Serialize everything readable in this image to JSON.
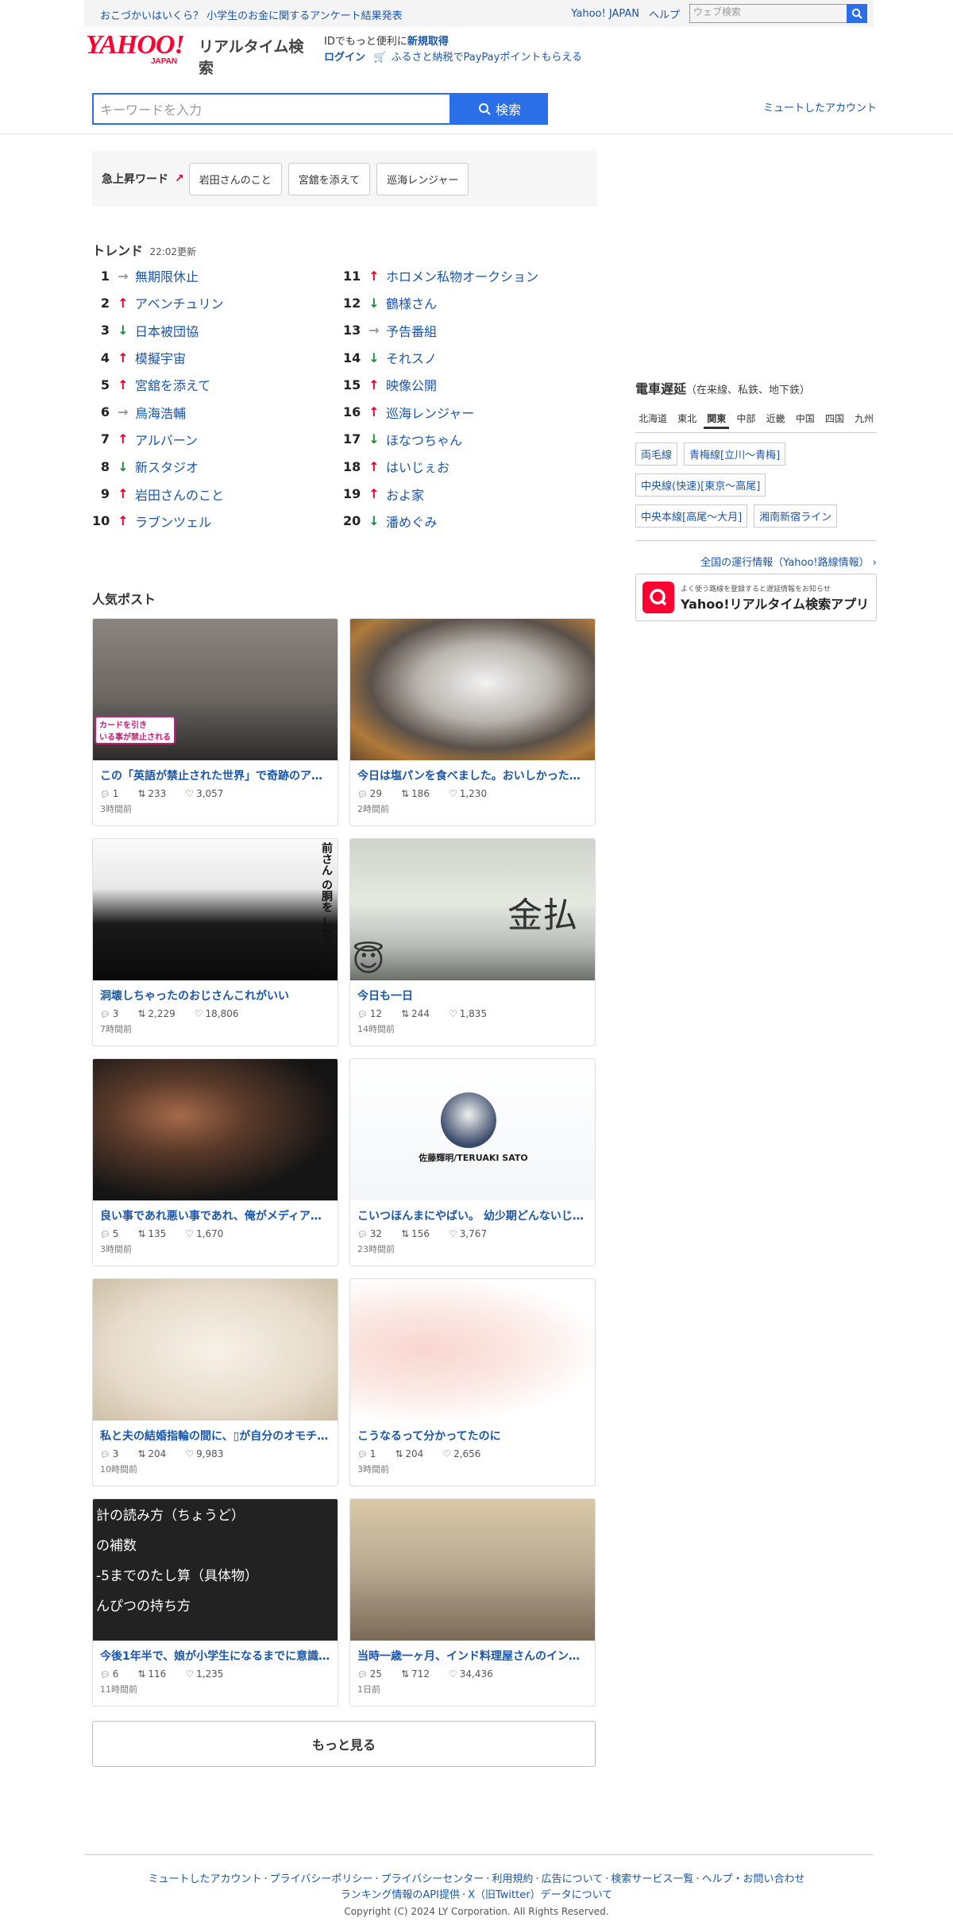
{
  "topbar": {
    "links": [
      "おこづかいはいくら？ 小学生のお金に関するアンケート結果発表"
    ],
    "yahoo_japan": "Yahoo! JAPAN",
    "help": "ヘルプ",
    "search_placeholder": "ウェブ検索"
  },
  "header": {
    "logo_text": "YAHOO!",
    "logo_sub": "JAPAN",
    "service_name": "リアルタイム検索",
    "info_prefix": "IDでもっと便利に",
    "info_register": "新規取得",
    "login": "ログイン",
    "furusato": "ふるさと納税でPayPayポイントもらえる",
    "search_placeholder": "キーワードを入力",
    "search_button": "検索",
    "muted_accounts": "ミュートしたアカウント"
  },
  "rising": {
    "label": "急上昇ワード",
    "words": [
      "岩田さんのこと",
      "宮舘を添えて",
      "巡海レンジャー"
    ]
  },
  "trends": {
    "title": "トレンド",
    "updated": "22:02更新",
    "items": [
      {
        "rank": "1",
        "dir": "same",
        "word": "無期限休止"
      },
      {
        "rank": "2",
        "dir": "up",
        "word": "アベンチュリン"
      },
      {
        "rank": "3",
        "dir": "down",
        "word": "日本被団協"
      },
      {
        "rank": "4",
        "dir": "up",
        "word": "模擬宇宙"
      },
      {
        "rank": "5",
        "dir": "up",
        "word": "宮舘を添えて"
      },
      {
        "rank": "6",
        "dir": "same",
        "word": "鳥海浩輔"
      },
      {
        "rank": "7",
        "dir": "up",
        "word": "アルバーン"
      },
      {
        "rank": "8",
        "dir": "down",
        "word": "新スタジオ"
      },
      {
        "rank": "9",
        "dir": "up",
        "word": "岩田さんのこと"
      },
      {
        "rank": "10",
        "dir": "up",
        "word": "ラブンツェル"
      },
      {
        "rank": "11",
        "dir": "up",
        "word": "ホロメン私物オークション"
      },
      {
        "rank": "12",
        "dir": "down",
        "word": "鶴様さん"
      },
      {
        "rank": "13",
        "dir": "same",
        "word": "予告番組"
      },
      {
        "rank": "14",
        "dir": "down",
        "word": "それスノ"
      },
      {
        "rank": "15",
        "dir": "up",
        "word": "映像公開"
      },
      {
        "rank": "16",
        "dir": "up",
        "word": "巡海レンジャー"
      },
      {
        "rank": "17",
        "dir": "down",
        "word": "ほなつちゃん"
      },
      {
        "rank": "18",
        "dir": "up",
        "word": "はいじぇお"
      },
      {
        "rank": "19",
        "dir": "up",
        "word": "およ家"
      },
      {
        "rank": "20",
        "dir": "down",
        "word": "潘めぐみ"
      }
    ]
  },
  "posts": {
    "title": "人気ポスト",
    "items": [
      {
        "title": "この「英語が禁止された世界」で奇跡のア…",
        "replies": "1",
        "reposts": "233",
        "likes": "3,057",
        "time": "3時間前",
        "img_caption": "カードを引き\nいる事が禁止される"
      },
      {
        "title": "今日は塩パンを食べました。おいしかった…",
        "replies": "29",
        "reposts": "186",
        "likes": "1,230",
        "time": "2時間前",
        "img_caption": ""
      },
      {
        "title": "洞壊しちゃったのおじさんこれがいい",
        "replies": "3",
        "reposts": "2,229",
        "likes": "18,806",
        "time": "7時間前",
        "img_caption": "前さん の胴を したのか⁉"
      },
      {
        "title": "今日も一日",
        "replies": "12",
        "reposts": "244",
        "likes": "1,835",
        "time": "14時間前",
        "img_caption": "金払"
      },
      {
        "title": "良い事であれ悪い事であれ、俺がメディア…",
        "replies": "5",
        "reposts": "135",
        "likes": "1,670",
        "time": "3時間前",
        "img_caption": ""
      },
      {
        "title": "こいつほんまにやばい。 幼少期どんないじ…",
        "replies": "32",
        "reposts": "156",
        "likes": "3,767",
        "time": "23時間前",
        "img_caption": "佐藤輝明/TERUAKI SATO"
      },
      {
        "title": "私と夫の結婚指輪の間に、▯が自分のオモチ…",
        "replies": "3",
        "reposts": "204",
        "likes": "9,983",
        "time": "10時間前",
        "img_caption": ""
      },
      {
        "title": "こうなるって分かってたのに",
        "replies": "1",
        "reposts": "204",
        "likes": "2,656",
        "time": "3時間前",
        "img_caption": ""
      },
      {
        "title": "今後1年半で、娘が小学生になるまでに意識…",
        "replies": "6",
        "reposts": "116",
        "likes": "1,235",
        "time": "11時間前",
        "img_caption": "計の読み方（ちょうど）\nの補数\n-5までのたし算（具体物）\nんぴつの持ち方"
      },
      {
        "title": "当時一歳一ヶ月、インド料理屋さんのイン…",
        "replies": "25",
        "reposts": "712",
        "likes": "34,436",
        "time": "1日前",
        "img_caption": ""
      }
    ],
    "more": "もっと見る"
  },
  "train": {
    "title": "電車遅延",
    "subtitle": "（在来線、私鉄、地下鉄）",
    "regions": [
      "北海道",
      "東北",
      "関東",
      "中部",
      "近畿",
      "中国",
      "四国",
      "九州"
    ],
    "active_region": "関東",
    "lines": [
      "両毛線",
      "青梅線[立川〜青梅]",
      "中央線(快速)[東京〜高尾]",
      "中央本線[高尾〜大月]",
      "湘南新宿ライン"
    ],
    "all_link": "全国の運行情報（Yahoo!路線情報）",
    "app_small": "よく使う路線を登録すると遅延情報をお知らせ",
    "app_name": "Yahoo!リアルタイム検索アプリ"
  },
  "footer": {
    "links": [
      "ミュートしたアカウント",
      "プライバシーポリシー",
      "プライバシーセンター",
      "利用規約",
      "広告について",
      "検索サービス一覧",
      "ヘルプ・お問い合わせ"
    ],
    "links2": [
      "ランキング情報のAPI提供",
      "X（旧Twitter）データについて"
    ],
    "copyright": "Copyright (C) 2024 LY Corporation. All Rights Reserved."
  },
  "colors": {
    "accent": "#2a6ee8",
    "brand": "#ff0033",
    "link": "#1a56a8",
    "up": "#e0002a",
    "down": "#1f8a3b"
  }
}
